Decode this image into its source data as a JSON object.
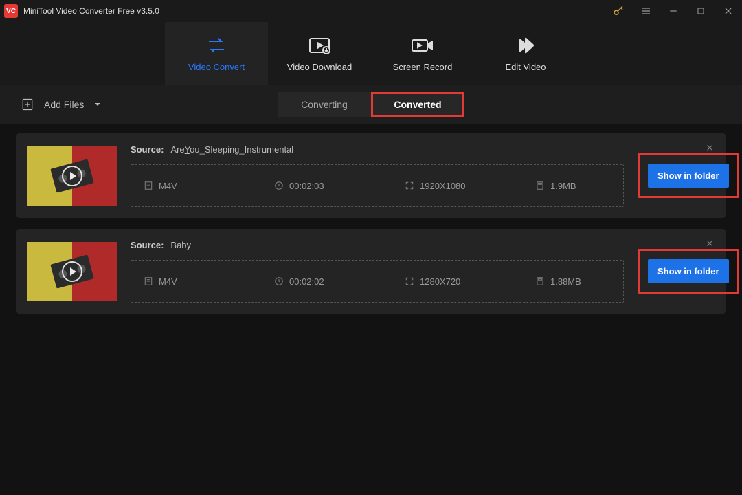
{
  "app": {
    "title": "MiniTool Video Converter Free v3.5.0",
    "logo_text": "VC"
  },
  "feature_tabs": {
    "convert": "Video Convert",
    "download": "Video Download",
    "record": "Screen Record",
    "edit": "Edit Video"
  },
  "toolbar": {
    "add_files": "Add Files"
  },
  "sub_tabs": {
    "converting": "Converting",
    "converted": "Converted"
  },
  "card_labels": {
    "source": "Source:",
    "show_in_folder": "Show in folder"
  },
  "files": [
    {
      "name_pre": "Are",
      "name_y": "Y",
      "name_post": "ou_Sleeping_Instrumental",
      "format": "M4V",
      "duration": "00:02:03",
      "resolution": "1920X1080",
      "size": "1.9MB"
    },
    {
      "name_pre": "Baby",
      "name_y": "",
      "name_post": "",
      "format": "M4V",
      "duration": "00:02:02",
      "resolution": "1280X720",
      "size": "1.88MB"
    }
  ]
}
